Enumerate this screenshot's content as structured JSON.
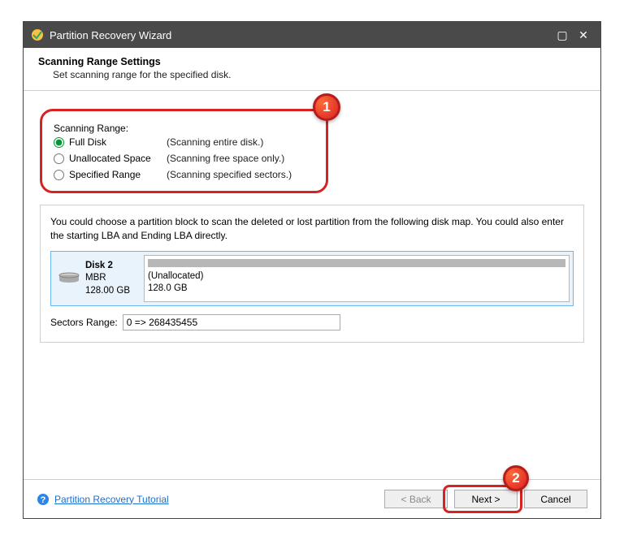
{
  "titlebar": {
    "title": "Partition Recovery Wizard"
  },
  "header": {
    "title": "Scanning Range Settings",
    "subtitle": "Set scanning range for the specified disk."
  },
  "scanRange": {
    "legend": "Scanning Range:",
    "options": [
      {
        "label": "Full Disk",
        "desc": "(Scanning entire disk.)"
      },
      {
        "label": "Unallocated Space",
        "desc": "(Scanning free space only.)"
      },
      {
        "label": "Specified Range",
        "desc": "(Scanning specified sectors.)"
      }
    ]
  },
  "diskPanel": {
    "hint": "You could choose a partition block to scan the deleted or lost partition from the following disk map. You could also enter the starting LBA and Ending LBA directly.",
    "disk": {
      "name": "Disk 2",
      "style": "MBR",
      "size": "128.00 GB"
    },
    "partition": {
      "type": "(Unallocated)",
      "size": "128.0 GB"
    },
    "sectorsLabel": "Sectors Range:",
    "sectorsValue": "0 => 268435455"
  },
  "footer": {
    "help": "Partition Recovery Tutorial",
    "back": "< Back",
    "next": "Next >",
    "cancel": "Cancel"
  },
  "badges": {
    "b1": "1",
    "b2": "2"
  }
}
